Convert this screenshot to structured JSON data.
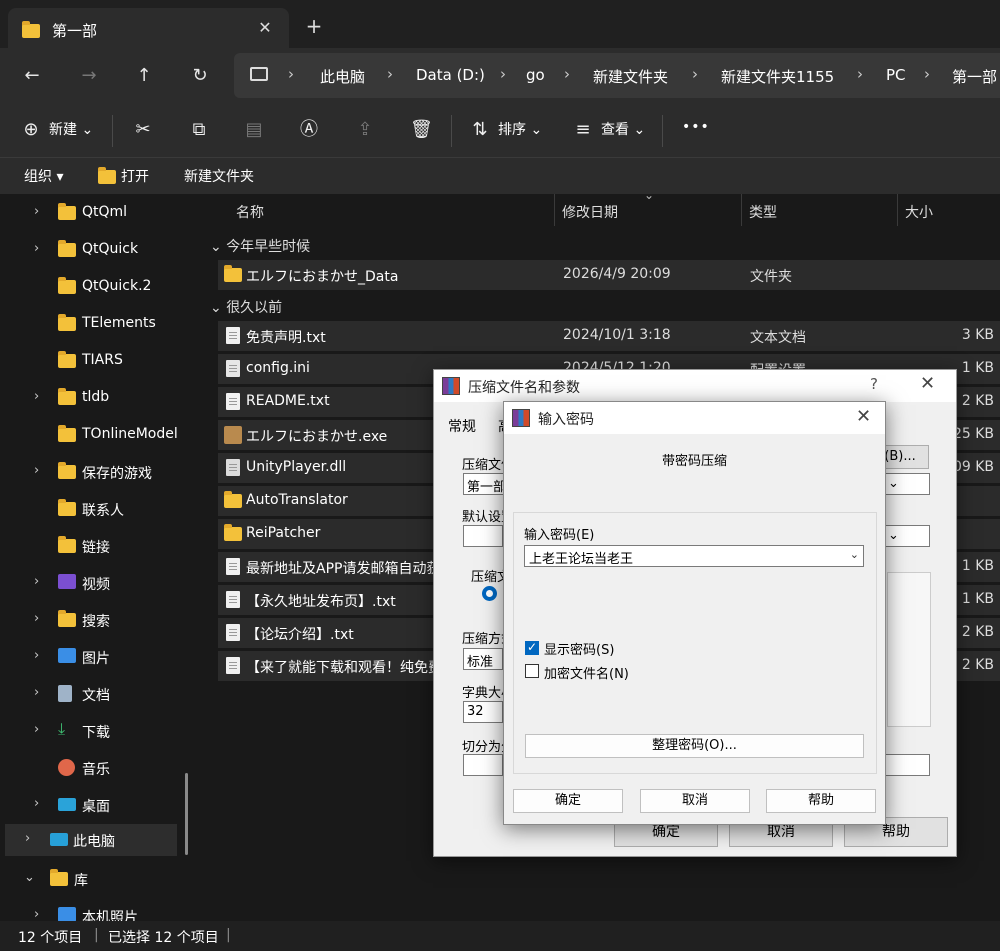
{
  "tab": {
    "title": "第一部",
    "close": "✕",
    "new": "+"
  },
  "nav": {
    "back": "←",
    "forward": "→",
    "up": "↑",
    "refresh": "↻"
  },
  "address": {
    "crumbs": [
      "此电脑",
      "Data (D:)",
      "go",
      "新建文件夹",
      "新建文件夹1155",
      "PC",
      "第一部"
    ]
  },
  "toolbar": {
    "new_label": "新建",
    "sort_label": "排序",
    "view_label": "查看",
    "more": "•••"
  },
  "commands": {
    "organize": "组织",
    "open": "打开",
    "new_folder": "新建文件夹"
  },
  "sidebar": {
    "items": [
      {
        "label": "QtQml",
        "chev": "›",
        "icon": "folder"
      },
      {
        "label": "QtQuick",
        "chev": "›",
        "icon": "folder"
      },
      {
        "label": "QtQuick.2",
        "chev": "",
        "icon": "folder"
      },
      {
        "label": "TElements",
        "chev": "",
        "icon": "folder"
      },
      {
        "label": "TIARS",
        "chev": "",
        "icon": "folder"
      },
      {
        "label": "tldb",
        "chev": "›",
        "icon": "folder"
      },
      {
        "label": "TOnlineModel",
        "chev": "",
        "icon": "folder"
      },
      {
        "label": "保存的游戏",
        "chev": "›",
        "icon": "folder"
      },
      {
        "label": "联系人",
        "chev": "",
        "icon": "folder"
      },
      {
        "label": "链接",
        "chev": "",
        "icon": "folder"
      },
      {
        "label": "视频",
        "chev": "›",
        "icon": "video"
      },
      {
        "label": "搜索",
        "chev": "›",
        "icon": "folder"
      },
      {
        "label": "图片",
        "chev": "›",
        "icon": "pictures"
      },
      {
        "label": "文档",
        "chev": "›",
        "icon": "documents"
      },
      {
        "label": "下载",
        "chev": "›",
        "icon": "download"
      },
      {
        "label": "音乐",
        "chev": "",
        "icon": "music"
      },
      {
        "label": "桌面",
        "chev": "›",
        "icon": "desktop"
      },
      {
        "label": "此电脑",
        "chev": "›",
        "icon": "pc"
      },
      {
        "label": "库",
        "chev": "⌄",
        "icon": "folder"
      },
      {
        "label": "本机照片",
        "chev": "›",
        "icon": "pictures"
      }
    ]
  },
  "columns": {
    "name": "名称",
    "date": "修改日期",
    "type": "类型",
    "size": "大小"
  },
  "groups": {
    "recent": "今年早些时候",
    "old": "很久以前"
  },
  "files": [
    {
      "name": "エルフにおまかせ_Data",
      "date": "2026/4/9 20:09",
      "type": "文件夹",
      "size": "",
      "icon": "folder"
    },
    {
      "name": "免责声明.txt",
      "date": "2024/10/1 3:18",
      "type": "文本文档",
      "size": "3 KB",
      "icon": "doc"
    },
    {
      "name": "config.ini",
      "date": "2024/5/12 1:20",
      "type": "配置设置",
      "size": "1 KB",
      "icon": "ini"
    },
    {
      "name": "README.txt",
      "date": "",
      "type": "",
      "size": "2 KB",
      "icon": "doc"
    },
    {
      "name": "エルフにおまかせ.exe",
      "date": "",
      "type": "",
      "size": "25 KB",
      "icon": "exe"
    },
    {
      "name": "UnityPlayer.dll",
      "date": "",
      "type": "",
      "size": "09 KB",
      "icon": "dll"
    },
    {
      "name": "AutoTranslator",
      "date": "",
      "type": "",
      "size": "",
      "icon": "folder"
    },
    {
      "name": "ReiPatcher",
      "date": "",
      "type": "",
      "size": "",
      "icon": "folder"
    },
    {
      "name": "最新地址及APP请发邮箱自动获",
      "date": "",
      "type": "",
      "size": "1 KB",
      "icon": "doc"
    },
    {
      "name": "【永久地址发布页】.txt",
      "date": "",
      "type": "",
      "size": "1 KB",
      "icon": "doc"
    },
    {
      "name": "【论坛介绍】.txt",
      "date": "",
      "type": "",
      "size": "2 KB",
      "icon": "doc"
    },
    {
      "name": "【来了就能下载和观看！纯免费",
      "date": "",
      "type": "",
      "size": "2 KB",
      "icon": "doc"
    }
  ],
  "status": {
    "count": "12 个项目",
    "selected": "已选择 12 个项目"
  },
  "archive_dialog": {
    "title": "压缩文件名和参数",
    "help": "?",
    "close": "✕",
    "tab_general": "常规",
    "tab_advanced": "高",
    "archive_name_label": "压缩文件",
    "archive_name_value": "第一部",
    "browse": "(B)...",
    "default_label": "默认设置",
    "format_label": "压缩文",
    "method_label": "压缩方式",
    "method_value": "标准",
    "dict_label": "字典大小",
    "dict_value": "32",
    "split_label": "切分为分",
    "ok": "确定",
    "cancel": "取消",
    "helpbtn": "帮助"
  },
  "password_dialog": {
    "title": "输入密码",
    "close": "✕",
    "heading": "带密码压缩",
    "input_label": "输入密码(E)",
    "password": "上老王论坛当老王",
    "show_password": "显示密码(S)",
    "show_password_checked": true,
    "encrypt_names": "加密文件名(N)",
    "encrypt_names_checked": false,
    "organize": "整理密码(O)...",
    "ok": "确定",
    "cancel": "取消",
    "help": "帮助"
  }
}
